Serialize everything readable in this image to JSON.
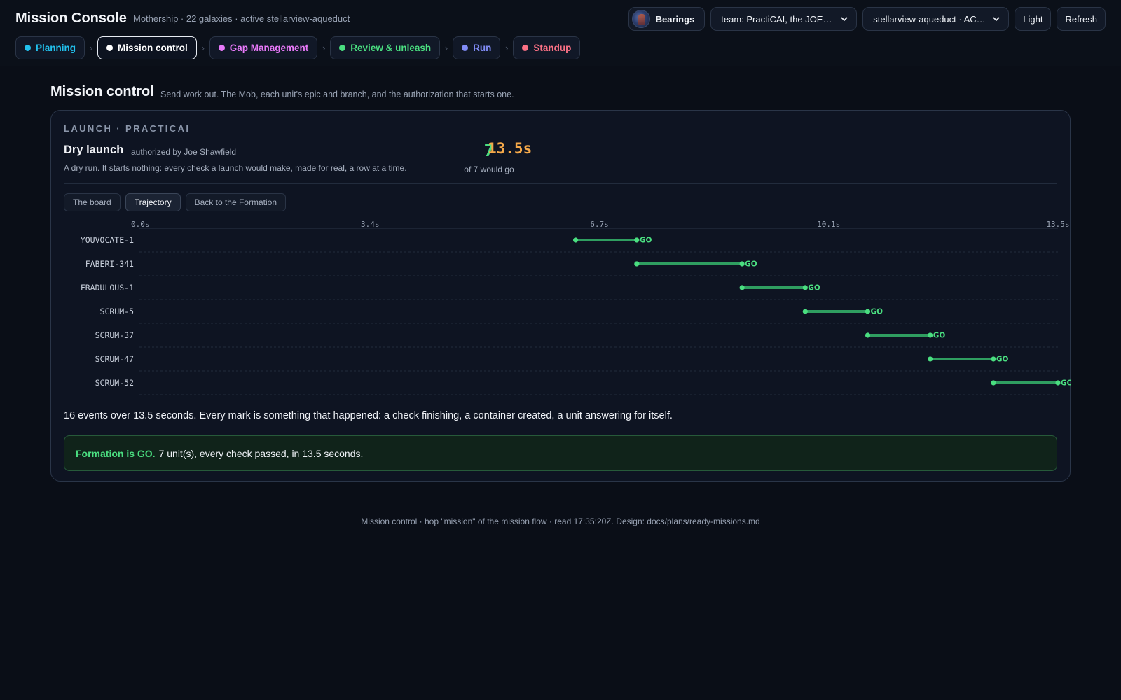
{
  "header": {
    "title": "Mission Console",
    "subtitle": "Mothership · 22 galaxies · active stellarview-aqueduct",
    "bearings_label": "Bearings",
    "team_select": "team: PractiCAI, the JOEY…",
    "repo_select": "stellarview-aqueduct · AC…",
    "theme_button": "Light",
    "refresh_button": "Refresh"
  },
  "crumbs": [
    {
      "label": "Planning",
      "color": "#22c1ee"
    },
    {
      "label": "Mission control",
      "color": "#ffffff",
      "active": true
    },
    {
      "label": "Gap Management",
      "color": "#e879f9"
    },
    {
      "label": "Review & unleash",
      "color": "#4ade80"
    },
    {
      "label": "Run",
      "color": "#818cf8"
    },
    {
      "label": "Standup",
      "color": "#fb7185"
    }
  ],
  "page": {
    "title": "Mission control",
    "subtitle": "Send work out. The Mob, each unit's epic and branch, and the authorization that starts one."
  },
  "card": {
    "eyebrow": "LAUNCH · PRACTICAI",
    "title": "Dry launch",
    "authorized": "authorized by Joe Shawfield",
    "description": "A dry run. It starts nothing: every check a launch would make, made for real, a row at a time.",
    "stat_count": "7",
    "stat_caption": "of 7 would go",
    "stat_duration": "13.5s",
    "tabs": [
      "The board",
      "Trajectory",
      "Back to the Formation"
    ],
    "active_tab": 1,
    "summary": "16 events over 13.5 seconds. Every mark is something that happened: a check finishing, a container created, a unit answering for itself.",
    "verdict_bold": "Formation is GO.",
    "verdict_rest": "7 unit(s), every check passed, in 13.5 seconds."
  },
  "chart_data": {
    "type": "gantt",
    "x_ticks": [
      "0.0s",
      "3.4s",
      "6.7s",
      "10.1s",
      "13.5s"
    ],
    "xlim": [
      0,
      13.5
    ],
    "units": "s",
    "rows": [
      {
        "label": "YOUVOCATE-1",
        "start": 6.4,
        "end": 7.3,
        "status": "GO"
      },
      {
        "label": "FABERI-341",
        "start": 7.3,
        "end": 8.85,
        "status": "GO"
      },
      {
        "label": "FRADULOUS-1",
        "start": 8.85,
        "end": 9.78,
        "status": "GO"
      },
      {
        "label": "SCRUM-5",
        "start": 9.78,
        "end": 10.7,
        "status": "GO"
      },
      {
        "label": "SCRUM-37",
        "start": 10.7,
        "end": 11.62,
        "status": "GO"
      },
      {
        "label": "SCRUM-47",
        "start": 11.62,
        "end": 12.55,
        "status": "GO"
      },
      {
        "label": "SCRUM-52",
        "start": 12.55,
        "end": 13.5,
        "status": "GO"
      }
    ],
    "go_color": "#4ade80",
    "bar_color": "#2f9e60"
  },
  "footer": "Mission control · hop \"mission\" of the mission flow · read 17:35:20Z. Design: docs/plans/ready-missions.md"
}
